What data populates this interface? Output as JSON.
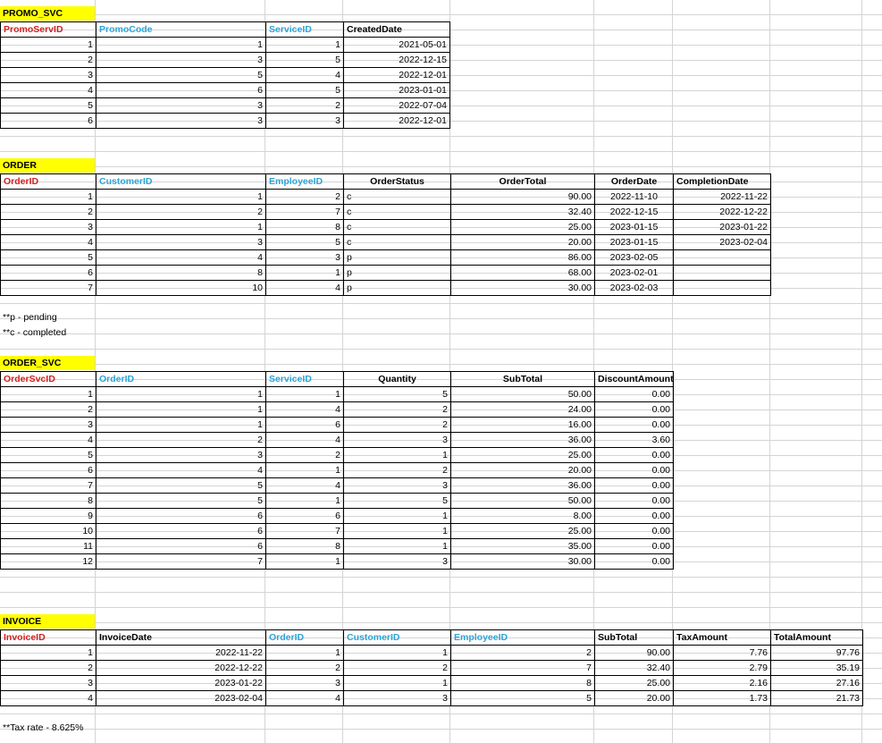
{
  "promo_svc": {
    "title": "PROMO_SVC",
    "headers": [
      "PromoServID",
      "PromoCode",
      "ServiceID",
      "CreatedDate"
    ],
    "rows": [
      [
        "1",
        "1",
        "1",
        "2021-05-01"
      ],
      [
        "2",
        "3",
        "5",
        "2022-12-15"
      ],
      [
        "3",
        "5",
        "4",
        "2022-12-01"
      ],
      [
        "4",
        "6",
        "5",
        "2023-01-01"
      ],
      [
        "5",
        "3",
        "2",
        "2022-07-04"
      ],
      [
        "6",
        "3",
        "3",
        "2022-12-01"
      ]
    ]
  },
  "order": {
    "title": "ORDER",
    "headers": [
      "OrderID",
      "CustomerID",
      "EmployeeID",
      "OrderStatus",
      "OrderTotal",
      "OrderDate",
      "CompletionDate"
    ],
    "rows": [
      [
        "1",
        "1",
        "2",
        "c",
        "90.00",
        "2022-11-10",
        "2022-11-22"
      ],
      [
        "2",
        "2",
        "7",
        "c",
        "32.40",
        "2022-12-15",
        "2022-12-22"
      ],
      [
        "3",
        "1",
        "8",
        "c",
        "25.00",
        "2023-01-15",
        "2023-01-22"
      ],
      [
        "4",
        "3",
        "5",
        "c",
        "20.00",
        "2023-01-15",
        "2023-02-04"
      ],
      [
        "5",
        "4",
        "3",
        "p",
        "86.00",
        "2023-02-05",
        ""
      ],
      [
        "6",
        "8",
        "1",
        "p",
        "68.00",
        "2023-02-01",
        ""
      ],
      [
        "7",
        "10",
        "4",
        "p",
        "30.00",
        "2023-02-03",
        ""
      ]
    ],
    "notes": [
      "**p - pending",
      "**c - completed"
    ]
  },
  "order_svc": {
    "title": "ORDER_SVC",
    "headers": [
      "OrderSvcID",
      "OrderID",
      "ServiceID",
      "Quantity",
      "SubTotal",
      "DiscountAmount"
    ],
    "rows": [
      [
        "1",
        "1",
        "1",
        "5",
        "50.00",
        "0.00"
      ],
      [
        "2",
        "1",
        "4",
        "2",
        "24.00",
        "0.00"
      ],
      [
        "3",
        "1",
        "6",
        "2",
        "16.00",
        "0.00"
      ],
      [
        "4",
        "2",
        "4",
        "3",
        "36.00",
        "3.60"
      ],
      [
        "5",
        "3",
        "2",
        "1",
        "25.00",
        "0.00"
      ],
      [
        "6",
        "4",
        "1",
        "2",
        "20.00",
        "0.00"
      ],
      [
        "7",
        "5",
        "4",
        "3",
        "36.00",
        "0.00"
      ],
      [
        "8",
        "5",
        "1",
        "5",
        "50.00",
        "0.00"
      ],
      [
        "9",
        "6",
        "6",
        "1",
        "8.00",
        "0.00"
      ],
      [
        "10",
        "6",
        "7",
        "1",
        "25.00",
        "0.00"
      ],
      [
        "11",
        "6",
        "8",
        "1",
        "35.00",
        "0.00"
      ],
      [
        "12",
        "7",
        "1",
        "3",
        "30.00",
        "0.00"
      ]
    ]
  },
  "invoice": {
    "title": "INVOICE",
    "headers": [
      "InvoiceID",
      "InvoiceDate",
      "OrderID",
      "CustomerID",
      "EmployeeID",
      "SubTotal",
      "TaxAmount",
      "TotalAmount"
    ],
    "rows": [
      [
        "1",
        "2022-11-22",
        "1",
        "1",
        "2",
        "90.00",
        "7.76",
        "97.76"
      ],
      [
        "2",
        "2022-12-22",
        "2",
        "2",
        "7",
        "32.40",
        "2.79",
        "35.19"
      ],
      [
        "3",
        "2023-01-22",
        "3",
        "1",
        "8",
        "25.00",
        "2.16",
        "27.16"
      ],
      [
        "4",
        "2023-02-04",
        "4",
        "3",
        "5",
        "20.00",
        "1.73",
        "21.73"
      ]
    ],
    "note": "**Tax rate - 8.625%"
  }
}
